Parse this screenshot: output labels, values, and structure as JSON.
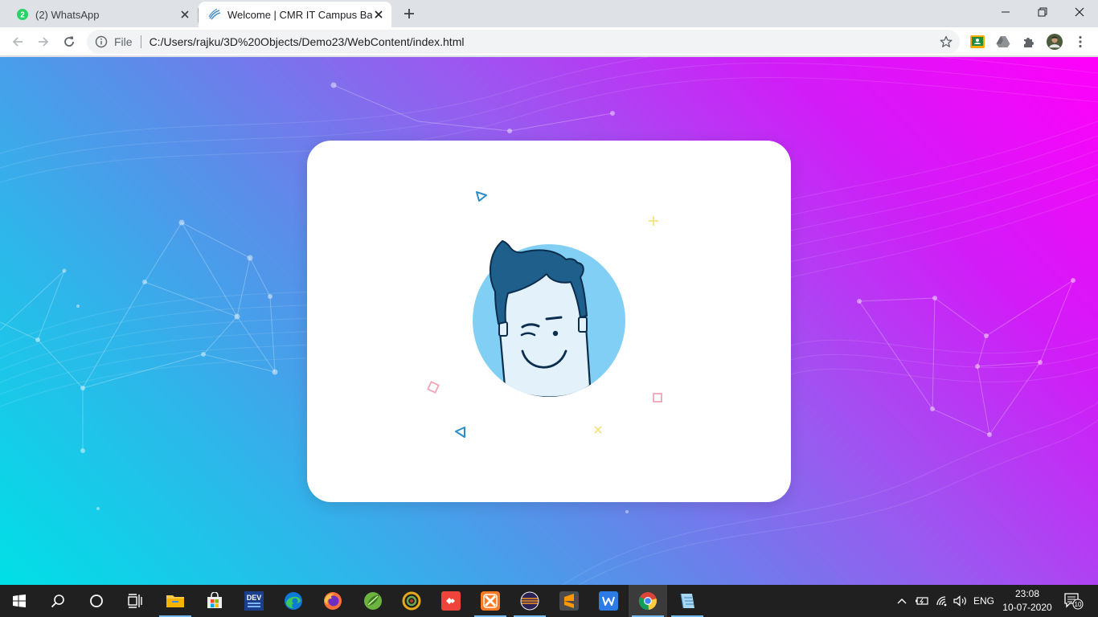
{
  "browser": {
    "tabs": [
      {
        "title": "(2) WhatsApp",
        "badge": "2",
        "active": false
      },
      {
        "title": "Welcome | CMR IT Campus Bank",
        "active": true
      }
    ],
    "omnibox": {
      "scheme_label": "File",
      "url": "C:/Users/rajku/3D%20Objects/Demo23/WebContent/index.html"
    },
    "extensions": [
      "google-classroom-icon",
      "drive-icon",
      "extensions-puzzle-icon",
      "profile-avatar",
      "kebab-menu-icon"
    ]
  },
  "page": {
    "background_colors": [
      "#00e0e6",
      "#9b58f0",
      "#ff00fa"
    ],
    "card": {
      "illustration": "winking-cartoon-face",
      "face_circle_color": "#82cff5",
      "hair_color": "#1e5f8c",
      "confetti_colors": [
        "#2a8fc8",
        "#f3e58a",
        "#f4a3b4"
      ]
    }
  },
  "taskbar": {
    "apps": [
      "start-icon",
      "search-icon",
      "cortana-icon",
      "task-view-icon",
      "file-explorer-icon",
      "microsoft-store-icon",
      "dev-cpp-icon",
      "edge-icon",
      "firefox-icon",
      "spring-tool-suite-icon",
      "eclipse-chameleon-icon",
      "anydesk-icon",
      "xampp-icon",
      "eclipse-icon",
      "sublime-text-icon",
      "wps-writer-icon",
      "chrome-icon",
      "notepad-icon"
    ],
    "dev_label": "DEV",
    "tray": {
      "language": "ENG",
      "time": "23:08",
      "date": "10-07-2020",
      "notifications": "10"
    }
  }
}
